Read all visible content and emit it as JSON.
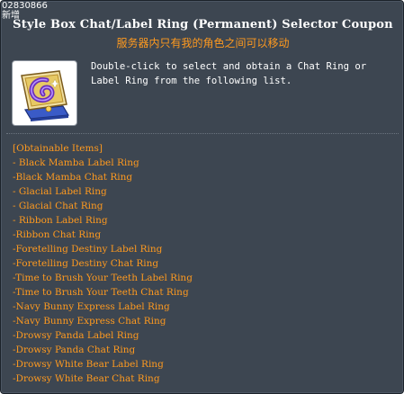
{
  "tooltip": {
    "item_id": "02830866",
    "new_tag": "新增",
    "title": "Style Box Chat/Label Ring (Permanent) Selector Coupon",
    "trade_note": "服务器内只有我的角色之间可以移动",
    "description": "Double-click to select and obtain a Chat Ring or Label Ring from the following list.",
    "icon": "coupon-box-icon",
    "items_header": "[Obtainable Items]",
    "items": [
      "- Black Mamba Label Ring",
      "-Black Mamba Chat Ring",
      "- Glacial Label Ring",
      "- Glacial Chat Ring",
      "- Ribbon Label Ring",
      "-Ribbon Chat Ring",
      "-Foretelling Destiny Label Ring",
      "-Foretelling Destiny Chat Ring",
      "-Time to Brush Your Teeth Label Ring",
      "-Time to Brush Your Teeth Chat Ring",
      "-Navy Bunny Express Label Ring",
      "-Navy Bunny Express Chat Ring",
      "-Drowsy Panda Label Ring",
      "-Drowsy Panda Chat Ring",
      "-Drowsy White Bear Label Ring",
      "-Drowsy White Bear Chat Ring"
    ]
  },
  "colors": {
    "background": "#3d4651",
    "title": "#ffffff",
    "accent_orange": "#ff9a1f",
    "description": "#ffffff"
  }
}
